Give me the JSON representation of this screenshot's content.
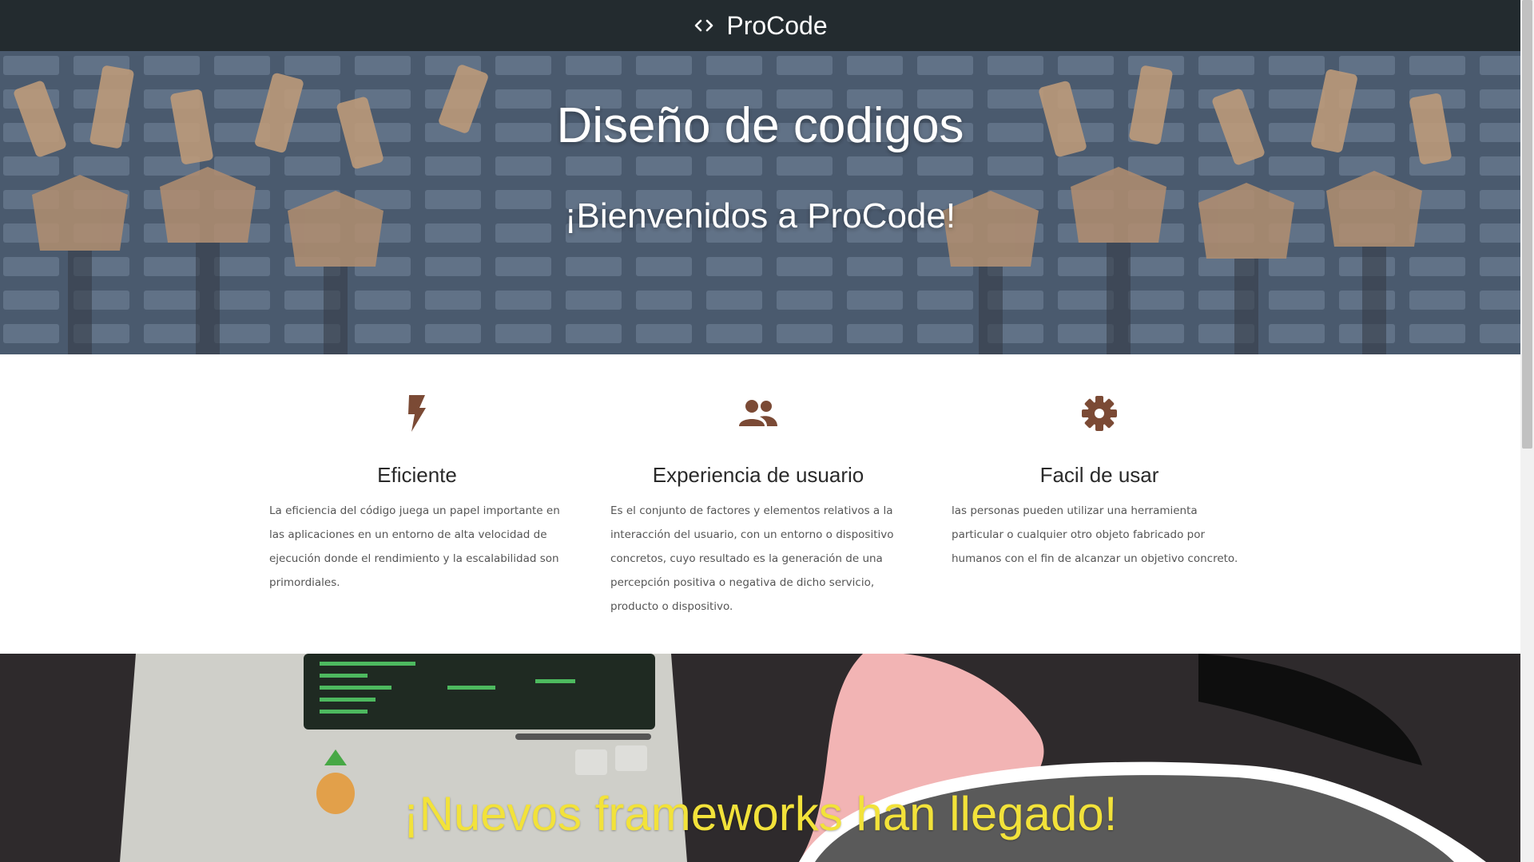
{
  "header": {
    "brand": "ProCode",
    "icon": "code-brackets-icon"
  },
  "hero": {
    "title": "Diseño de codigos",
    "subtitle": "¡Bienvenidos a ProCode!"
  },
  "features": [
    {
      "icon": "lightning-bolt-icon",
      "title": "Eficiente",
      "text": "La eficiencia del código juega un papel importante en las aplicaciones en un entorno de alta velocidad de ejecución donde el rendimiento y la escalabilidad son primordiales."
    },
    {
      "icon": "users-icon",
      "title": "Experiencia de usuario",
      "text": "Es el conjunto de factores y elementos relativos a la interacción del usuario, con un entorno o dispositivo concretos, cuyo resultado es la generación de una percepción positiva o negativa de dicho servicio, producto o dispositivo."
    },
    {
      "icon": "gear-icon",
      "title": "Facil de usar",
      "text": "las personas pueden utilizar una herramienta particular o cualquier otro objeto fabricado por humanos con el fin de alcanzar un objetivo concreto."
    }
  ],
  "banner": {
    "title": "¡Nuevos frameworks han llegado!"
  },
  "colors": {
    "header_bg": "#232b2f",
    "icon_brown": "#7b4a35",
    "banner_text": "#f2e23a"
  }
}
